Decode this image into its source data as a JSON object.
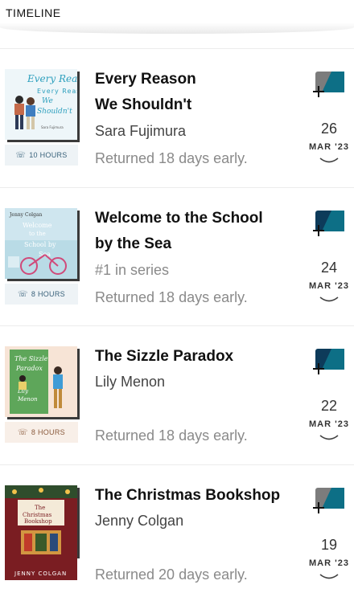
{
  "header": {
    "title": "TIMELINE"
  },
  "books": [
    {
      "title_line1": "Every Reason",
      "title_line2": "We Shouldn't",
      "meta1": "Sara Fujimura",
      "status": "Returned 18 days early.",
      "duration": "10 HOURS",
      "day": "26",
      "month": "MAR '23",
      "cover_title": "Every Reason We Shouldn't",
      "cover_author": "Sara Fujimura"
    },
    {
      "title_line1": "Welcome to the School",
      "title_line2": "by the Sea",
      "meta1": "#1 in series",
      "status": "Returned 18 days early.",
      "duration": "8 HOURS",
      "day": "24",
      "month": "MAR '23",
      "cover_title": "Welcome to the School by the Sea",
      "cover_author": "Jenny Colgan"
    },
    {
      "title_line1": "The Sizzle Paradox",
      "meta1": "Lily Menon",
      "status": "Returned 18 days early.",
      "duration": "8 HOURS",
      "day": "22",
      "month": "MAR '23",
      "cover_title": "The Sizzle Paradox",
      "cover_author": "Lily Menon"
    },
    {
      "title_line1": "The Christmas Bookshop",
      "meta1": "Jenny Colgan",
      "status": "Returned 20 days early.",
      "duration": "",
      "day": "19",
      "month": "MAR '23",
      "cover_title": "The Christmas Bookshop",
      "cover_author": "JENNY COLGAN"
    }
  ]
}
